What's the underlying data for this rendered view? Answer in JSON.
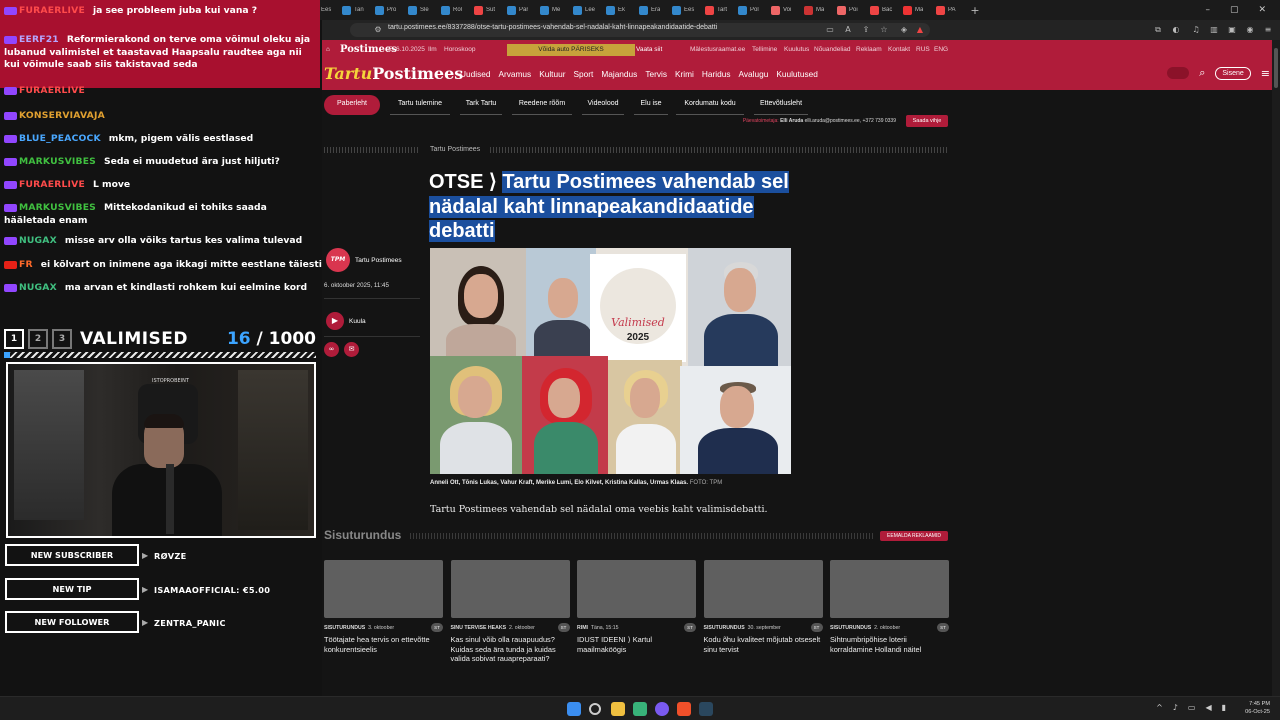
{
  "browser": {
    "tabs": [
      "Per",
      "",
      "Pe",
      "Fo",
      "VA",
      "Ug",
      "PK",
      "Isu",
      "AK",
      "Ees",
      "Tan",
      "Pro",
      "Sle",
      "Rol",
      "Sut",
      "Par",
      "Me",
      "Lee",
      "Ek",
      "Era",
      "Ees",
      "Tart",
      "Pol",
      "Voi",
      "Ma",
      "Poi",
      "Bac",
      "Ma",
      "PA"
    ],
    "url": "tartu.postimees.ee/8337288/otse-tartu-postimees-vahendab-sel-nadalal-kaht-linnapeakandidaatide-debatti"
  },
  "stream": {
    "chat": [
      {
        "user": "FURAERLIVE",
        "text": "ja see probleem juba kui vana ?",
        "color": "#ff4b4b",
        "badge": "twitch"
      },
      {
        "user": "EERF21",
        "text": "Reformierakond on terve oma võimul oleku aja lubanud valimistel et taastavad Haapsalu raudtee aga nii kui võimule saab siis takistavad seda",
        "color": "#b5a6ff",
        "badge": "twitch"
      },
      {
        "user": "FURAERLIVE",
        "text": "",
        "color": "#ff4b4b",
        "badge": "twitch"
      },
      {
        "user": "KONSERVIAVAJA",
        "text": "",
        "color": "#e0a030",
        "badge": "twitch"
      },
      {
        "user": "BLUE_PEACOCK",
        "text": "mkm, pigem välis eestlased",
        "color": "#4aa8ff",
        "badge": "twitch"
      },
      {
        "user": "MARKUSVIBES",
        "text": "Seda ei muudetud ära just hiljuti?",
        "color": "#40c040",
        "badge": "twitch"
      },
      {
        "user": "FURAERLIVE",
        "text": "L move",
        "color": "#ff4b4b",
        "badge": "twitch"
      },
      {
        "user": "MARKUSVIBES",
        "text": "Mittekodanikud ei tohiks saada hääletada enam",
        "color": "#40c040",
        "badge": "twitch"
      },
      {
        "user": "NUGAX",
        "text": "misse arv olla võiks tartus kes valima tulevad",
        "color": "#40c080",
        "badge": "twitch"
      },
      {
        "user": "FR",
        "text": "ei kõlvart on inimene aga ikkagi mitte eestlane täiesti",
        "color": "#ff6a2a",
        "badge": "yt"
      },
      {
        "user": "NUGAX",
        "text": "ma arvan et kindlasti rohkem kui eelmine kord",
        "color": "#40c080",
        "badge": "twitch"
      }
    ],
    "valimised": {
      "steps": [
        "1",
        "2",
        "3"
      ],
      "title": "VALIMISED",
      "current": "16",
      "separator": "/",
      "total": "1000",
      "progress": 0.016
    },
    "webcam_sign": "ISTOPROBEINT",
    "alerts": [
      {
        "label": "NEW SUBSCRIBER",
        "value": "RØVZE"
      },
      {
        "label": "NEW TIP",
        "value": "ISAMAAOFFICIAL: €5.00"
      },
      {
        "label": "NEW FOLLOWER",
        "value": "ZENTRA_PANIC"
      }
    ]
  },
  "site": {
    "topbar": {
      "brand": "Postimees",
      "date": "E, 6.10.2025",
      "weather": "Ilm",
      "horoscope": "Horoskoop",
      "promo": "Võida auto PÄRISEKS",
      "promo_cta": "Vaata siit",
      "links": [
        "Mälestusraamat.ee",
        "Tellimine",
        "Kuulutus",
        "Nõuandeliad",
        "Reklaam",
        "Kontakt",
        "RUS",
        "ENG"
      ]
    },
    "logo": {
      "city": "Tartu",
      "brand": "Postimees"
    },
    "nav": [
      "Uudised",
      "Arvamus",
      "Kultuur",
      "Sport",
      "Majandus",
      "Tervis",
      "Krimi",
      "Haridus",
      "Avalugu",
      "Kuulutused"
    ],
    "login": "Sisene",
    "subnav": [
      "Paberleht",
      "Tartu tulemine",
      "Tark Tartu",
      "Reedene rõõm",
      "Videolood",
      "Elu ise",
      "Kordumatu kodu",
      "Ettevõtlusleht"
    ],
    "editor": {
      "label": "Päevatoimetaja:",
      "name": "Elli Aruda",
      "contact": "elli.aruda@postimees.ee, +372 739 0339",
      "tip": "Saada vihje"
    },
    "section": "Tartu Postimees",
    "headline": {
      "prefix": "OTSE",
      "title": "Tartu Postimees vahendab sel nädalal kaht linnapeakandidaatide debatti"
    },
    "author": "Tartu Postimees",
    "author_avatar": "TPM",
    "date": "6. oktoober 2025, 11:45",
    "listen": "Kuula",
    "photo_badge": {
      "word": "Valimised",
      "year": "2025"
    },
    "caption": "Anneli Ott, Tõnis Lukas, Vahur Kraft, Merike Lumi, Elo Kilvet, Kristina Kallas, Urmas Klaas.",
    "caption_credit": "FOTO: TPM",
    "lead": "Tartu Postimees vahendab sel nädalal oma veebis kaht valimisdebatti.",
    "sisuturundus": "Sisuturundus",
    "remove_ads": "EEMALDA REKLAAMID",
    "cards": [
      {
        "tag": "SISUTURUNDUS",
        "date": "3. oktoober",
        "title": "Töötajate hea tervis on ettevõtte konkurentsieelis"
      },
      {
        "tag": "SINU TERVISE HEAKS",
        "date": "2. oktoober",
        "title": "Kas sinul võib olla rauapuudus? Kuidas seda ära tunda ja kuidas valida sobivat rauapreparaati?"
      },
      {
        "tag": "RIMI",
        "date": "Täna, 15:15",
        "title": "IDUST IDEENI ⟩ Kartul maailmaköögis"
      },
      {
        "tag": "SISUTURUNDUS",
        "date": "30. september",
        "title": "Kodu õhu kvaliteet mõjutab otseselt sinu tervist"
      },
      {
        "tag": "SISUTURUNDUS",
        "date": "2. oktoober",
        "title": "Sihtnumbripõhise loterii korraldamine Hollandi näitel"
      }
    ],
    "card_badge": "ST"
  },
  "taskbar": {
    "time": "7:45 PM",
    "date": "06-Oct-25"
  },
  "colors": {
    "brand_red": "#b01c3a",
    "highlight": "#1b4f9e",
    "progress_blue": "#3ca4ff"
  }
}
